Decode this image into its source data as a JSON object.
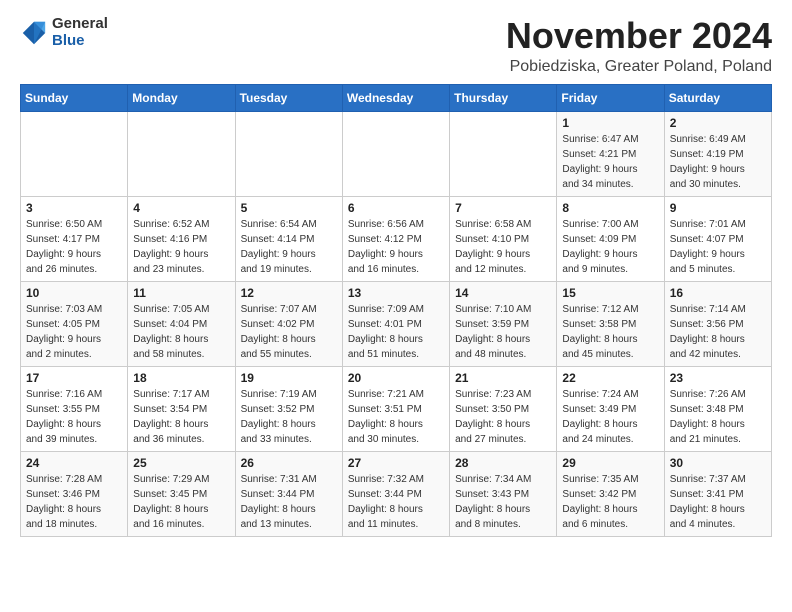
{
  "logo": {
    "line1": "General",
    "line2": "Blue"
  },
  "header": {
    "month": "November 2024",
    "location": "Pobiedziska, Greater Poland, Poland"
  },
  "weekdays": [
    "Sunday",
    "Monday",
    "Tuesday",
    "Wednesday",
    "Thursday",
    "Friday",
    "Saturday"
  ],
  "weeks": [
    [
      {
        "day": "",
        "info": ""
      },
      {
        "day": "",
        "info": ""
      },
      {
        "day": "",
        "info": ""
      },
      {
        "day": "",
        "info": ""
      },
      {
        "day": "",
        "info": ""
      },
      {
        "day": "1",
        "info": "Sunrise: 6:47 AM\nSunset: 4:21 PM\nDaylight: 9 hours\nand 34 minutes."
      },
      {
        "day": "2",
        "info": "Sunrise: 6:49 AM\nSunset: 4:19 PM\nDaylight: 9 hours\nand 30 minutes."
      }
    ],
    [
      {
        "day": "3",
        "info": "Sunrise: 6:50 AM\nSunset: 4:17 PM\nDaylight: 9 hours\nand 26 minutes."
      },
      {
        "day": "4",
        "info": "Sunrise: 6:52 AM\nSunset: 4:16 PM\nDaylight: 9 hours\nand 23 minutes."
      },
      {
        "day": "5",
        "info": "Sunrise: 6:54 AM\nSunset: 4:14 PM\nDaylight: 9 hours\nand 19 minutes."
      },
      {
        "day": "6",
        "info": "Sunrise: 6:56 AM\nSunset: 4:12 PM\nDaylight: 9 hours\nand 16 minutes."
      },
      {
        "day": "7",
        "info": "Sunrise: 6:58 AM\nSunset: 4:10 PM\nDaylight: 9 hours\nand 12 minutes."
      },
      {
        "day": "8",
        "info": "Sunrise: 7:00 AM\nSunset: 4:09 PM\nDaylight: 9 hours\nand 9 minutes."
      },
      {
        "day": "9",
        "info": "Sunrise: 7:01 AM\nSunset: 4:07 PM\nDaylight: 9 hours\nand 5 minutes."
      }
    ],
    [
      {
        "day": "10",
        "info": "Sunrise: 7:03 AM\nSunset: 4:05 PM\nDaylight: 9 hours\nand 2 minutes."
      },
      {
        "day": "11",
        "info": "Sunrise: 7:05 AM\nSunset: 4:04 PM\nDaylight: 8 hours\nand 58 minutes."
      },
      {
        "day": "12",
        "info": "Sunrise: 7:07 AM\nSunset: 4:02 PM\nDaylight: 8 hours\nand 55 minutes."
      },
      {
        "day": "13",
        "info": "Sunrise: 7:09 AM\nSunset: 4:01 PM\nDaylight: 8 hours\nand 51 minutes."
      },
      {
        "day": "14",
        "info": "Sunrise: 7:10 AM\nSunset: 3:59 PM\nDaylight: 8 hours\nand 48 minutes."
      },
      {
        "day": "15",
        "info": "Sunrise: 7:12 AM\nSunset: 3:58 PM\nDaylight: 8 hours\nand 45 minutes."
      },
      {
        "day": "16",
        "info": "Sunrise: 7:14 AM\nSunset: 3:56 PM\nDaylight: 8 hours\nand 42 minutes."
      }
    ],
    [
      {
        "day": "17",
        "info": "Sunrise: 7:16 AM\nSunset: 3:55 PM\nDaylight: 8 hours\nand 39 minutes."
      },
      {
        "day": "18",
        "info": "Sunrise: 7:17 AM\nSunset: 3:54 PM\nDaylight: 8 hours\nand 36 minutes."
      },
      {
        "day": "19",
        "info": "Sunrise: 7:19 AM\nSunset: 3:52 PM\nDaylight: 8 hours\nand 33 minutes."
      },
      {
        "day": "20",
        "info": "Sunrise: 7:21 AM\nSunset: 3:51 PM\nDaylight: 8 hours\nand 30 minutes."
      },
      {
        "day": "21",
        "info": "Sunrise: 7:23 AM\nSunset: 3:50 PM\nDaylight: 8 hours\nand 27 minutes."
      },
      {
        "day": "22",
        "info": "Sunrise: 7:24 AM\nSunset: 3:49 PM\nDaylight: 8 hours\nand 24 minutes."
      },
      {
        "day": "23",
        "info": "Sunrise: 7:26 AM\nSunset: 3:48 PM\nDaylight: 8 hours\nand 21 minutes."
      }
    ],
    [
      {
        "day": "24",
        "info": "Sunrise: 7:28 AM\nSunset: 3:46 PM\nDaylight: 8 hours\nand 18 minutes."
      },
      {
        "day": "25",
        "info": "Sunrise: 7:29 AM\nSunset: 3:45 PM\nDaylight: 8 hours\nand 16 minutes."
      },
      {
        "day": "26",
        "info": "Sunrise: 7:31 AM\nSunset: 3:44 PM\nDaylight: 8 hours\nand 13 minutes."
      },
      {
        "day": "27",
        "info": "Sunrise: 7:32 AM\nSunset: 3:44 PM\nDaylight: 8 hours\nand 11 minutes."
      },
      {
        "day": "28",
        "info": "Sunrise: 7:34 AM\nSunset: 3:43 PM\nDaylight: 8 hours\nand 8 minutes."
      },
      {
        "day": "29",
        "info": "Sunrise: 7:35 AM\nSunset: 3:42 PM\nDaylight: 8 hours\nand 6 minutes."
      },
      {
        "day": "30",
        "info": "Sunrise: 7:37 AM\nSunset: 3:41 PM\nDaylight: 8 hours\nand 4 minutes."
      }
    ]
  ]
}
